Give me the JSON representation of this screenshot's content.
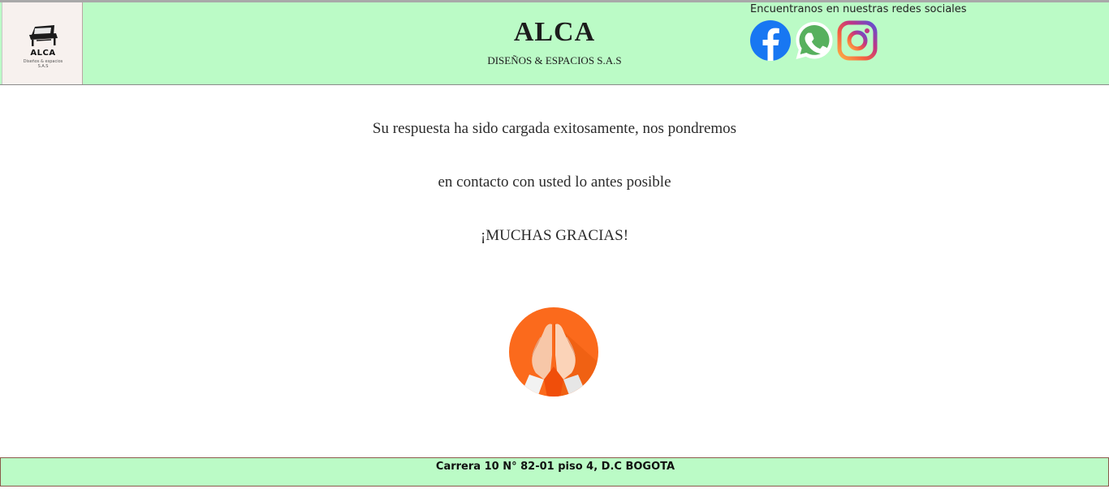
{
  "header": {
    "logo": {
      "name": "ALCA",
      "subtitle": "Diseños & espacios S.A.S"
    },
    "title": "ALCA",
    "subtitle": "DISEÑOS & ESPACIOS S.A.S",
    "social": {
      "label": "Encuentranos en nuestras redes sociales",
      "icons": [
        "facebook-icon",
        "whatsapp-icon",
        "instagram-icon"
      ]
    }
  },
  "main": {
    "line1": "Su respuesta ha sido cargada exitosamente, nos pondremos",
    "line2": "en contacto con usted lo antes posible",
    "line3": "¡MUCHAS GRACIAS!"
  },
  "footer": {
    "address": "Carrera 10 N° 82-01 piso 4, D.C BOGOTA"
  },
  "colors": {
    "header_bg": "#bbfbc6",
    "facebook": "#1877f2",
    "whatsapp": "#57b05e",
    "thanks_orange": "#fb6a1c"
  }
}
